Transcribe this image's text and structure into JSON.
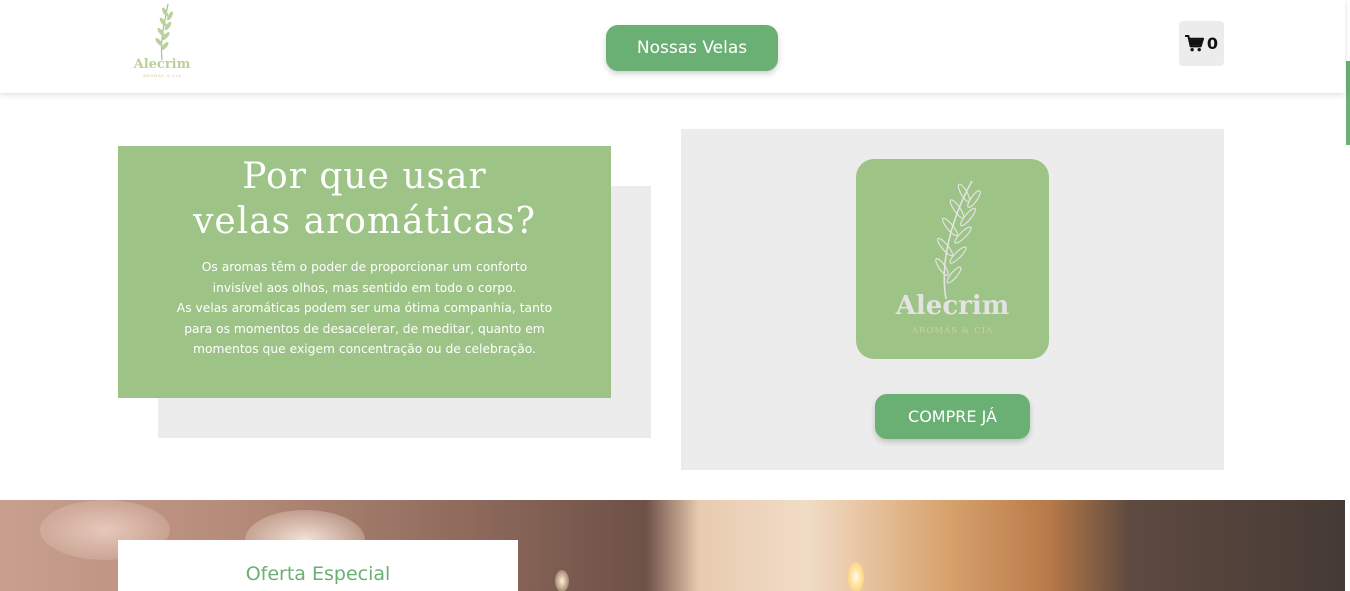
{
  "header": {
    "logo": {
      "name": "Alecrim",
      "subtitle": "AROMAS & CIA"
    },
    "nav_button_label": "Nossas Velas",
    "cart": {
      "icon": "cart-icon",
      "count": "0"
    }
  },
  "why": {
    "title_line1": "Por que usar",
    "title_line2": "velas aromáticas?",
    "text_lines": [
      "Os aromas têm o poder de proporcionar um conforto",
      "invisível aos olhos, mas sentido em todo o corpo.",
      "As velas aromáticas podem ser uma ótima companhia, tanto",
      "para os momentos de desacelerar, de meditar, quanto em",
      "momentos que exigem concentração ou de celebração."
    ]
  },
  "product": {
    "logo_name": "Alecrim",
    "logo_subtitle": "AROMAS & CIA",
    "buy_button_label": "COMPRE JÁ"
  },
  "banner": {
    "offer_title": "Oferta Especial"
  },
  "colors": {
    "accent_green": "#6aaf73",
    "card_green": "#9dc387",
    "panel_gray": "#ececec"
  }
}
